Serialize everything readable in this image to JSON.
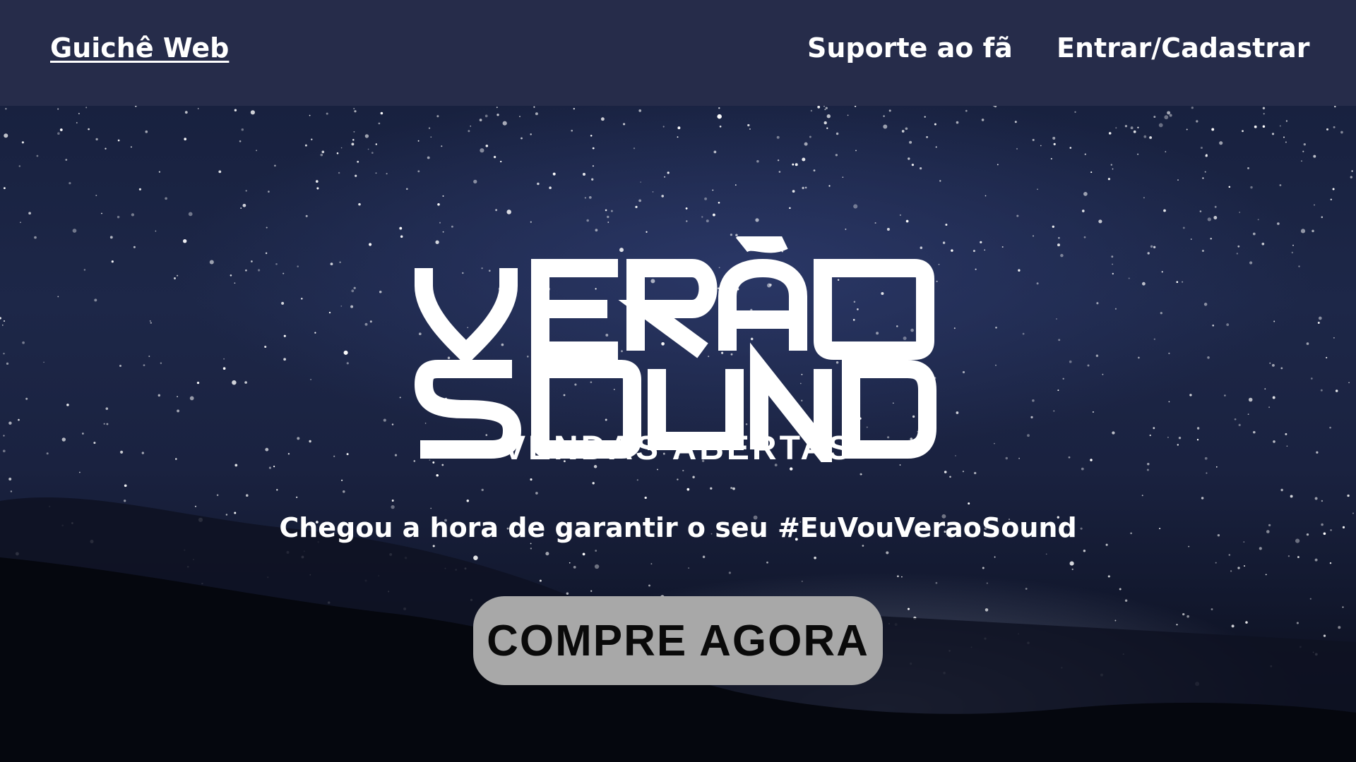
{
  "header": {
    "brand_label": "Guichê Web",
    "nav": {
      "support_label": "Suporte ao fã",
      "login_label": "Entrar/Cadastrar"
    }
  },
  "hero": {
    "logo_text": "VERÃO SOUND",
    "subtitle": "VENDAS ABERTAS",
    "tagline": "Chegou a hora de garantir o seu #EuVouVeraoSound",
    "cta_label": "COMPRE AGORA"
  },
  "colors": {
    "header_bg": "#262c4a",
    "cta_bg": "#a8a8a8",
    "text": "#ffffff"
  }
}
